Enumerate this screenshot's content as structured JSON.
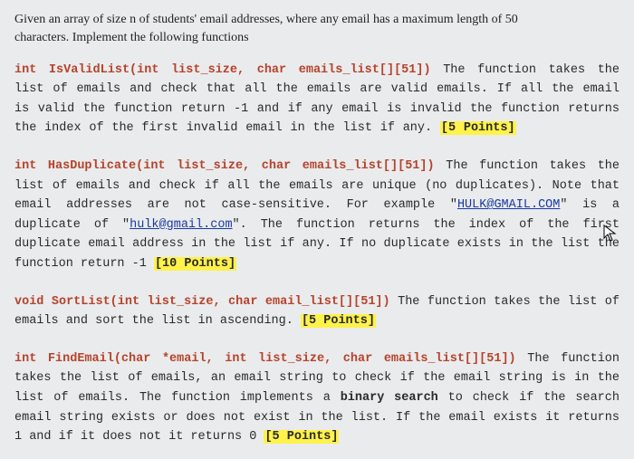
{
  "intro": {
    "l1": "Given an array of size n of students' email addresses, where any email has a maximum length of 50",
    "l2": "characters. Implement the following functions"
  },
  "p1": {
    "sig": "int IsValidList(int list_size, char emails_list[][51])",
    "text_a": " The function takes the list of emails and check that all the emails are valid emails. If all the email is valid the function return -1 and if any email is invalid the function returns the index of the first invalid email in the list if any. ",
    "points": "[5 Points]"
  },
  "p2": {
    "sig": "int HasDuplicate(int list_size, char emails_list[][51])",
    "text_a": " The function takes the list of emails and check if all the emails are unique (no duplicates). Note that email addresses are not case-sensitive. For example \"",
    "link1": "HULK@GMAIL.COM",
    "text_b": "\" is a duplicate of \"",
    "link2": "hulk@gmail.com",
    "text_c": "\". The function returns the index of the first duplicate email address in the list if any. If no duplicate exists in the list the function return -1 ",
    "points": "[10 Points]"
  },
  "p3": {
    "sig": "void SortList(int list_size, char email_list[][51])",
    "text_a": " The function takes the list of emails and sort the list in ascending. ",
    "points": "[5 Points]"
  },
  "p4": {
    "sig": "int FindEmail(char *email, int list_size, char emails_list[][51])",
    "text_a": " The function takes the list of emails, an email string to check if the email string is in the list of emails. The function implements a ",
    "bold1": "binary search",
    "text_b": " to check if the search email string exists or does not exist in the list. If the email exists it returns 1 and if it does not it returns 0 ",
    "points": "[5 Points]"
  }
}
